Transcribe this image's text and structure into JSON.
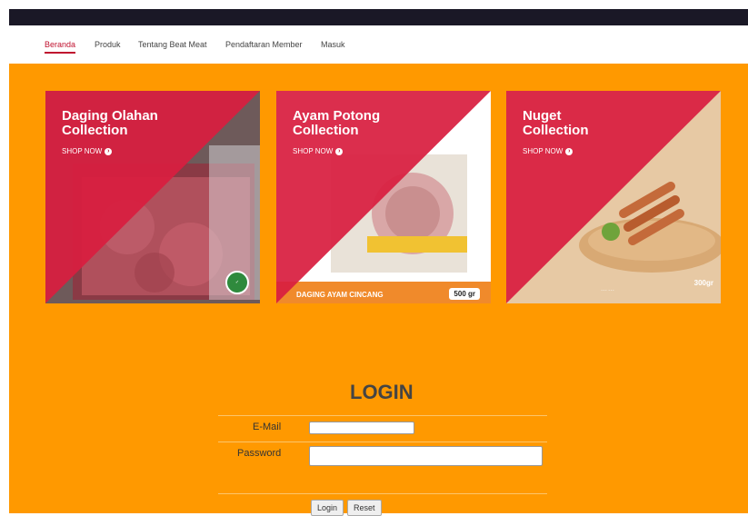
{
  "nav": {
    "items": [
      {
        "label": "Beranda",
        "active": true
      },
      {
        "label": "Produk",
        "active": false
      },
      {
        "label": "Tentang Beat Meat",
        "active": false
      },
      {
        "label": "Pendaftaran Member",
        "active": false
      },
      {
        "label": "Masuk",
        "active": false
      }
    ]
  },
  "cards": [
    {
      "title_line1": "Daging Olahan",
      "title_line2": "Collection",
      "cta": "SHOP NOW",
      "cta_icon": "arrow-right-circle-icon"
    },
    {
      "title_line1": "Ayam Potong",
      "title_line2": "Collection",
      "cta": "SHOP NOW",
      "cta_icon": "arrow-right-circle-icon",
      "product_label": "DAGING AYAM CINCANG",
      "weight": "500 gr"
    },
    {
      "title_line1": "Nuget",
      "title_line2": "Collection",
      "cta": "SHOP NOW",
      "cta_icon": "arrow-right-circle-icon",
      "weight": "300gr"
    }
  ],
  "login": {
    "title": "LOGIN",
    "email_label": "E-Mail",
    "email_value": "",
    "password_label": "Password",
    "password_value": "",
    "login_button": "Login",
    "reset_button": "Reset"
  },
  "colors": {
    "background": "#ff9900",
    "topbar": "#1a1826",
    "accent": "#c0122f",
    "card_red": "#d81e3f"
  }
}
